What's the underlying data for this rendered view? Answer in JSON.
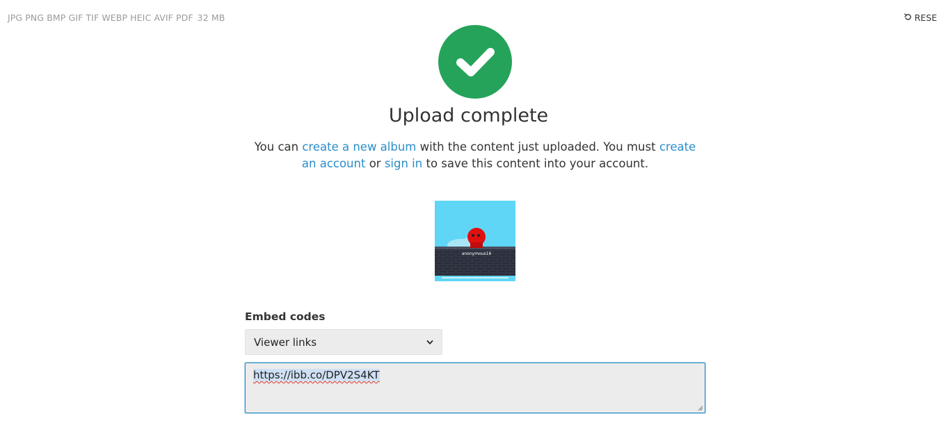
{
  "header": {
    "formats": "JPG PNG BMP GIF TIF WEBP HEIC AVIF PDF",
    "max_size": "32 MB",
    "reset_label": "RESE",
    "reset_icon": "undo-icon"
  },
  "status": {
    "icon": "check-circle-icon",
    "icon_color": "#25a35a",
    "title": "Upload complete"
  },
  "message": {
    "part1": "You can ",
    "link_album": "create a new album",
    "part2": " with the content just uploaded. You must ",
    "link_account": "create an account",
    "part3": " or ",
    "link_signin": "sign in",
    "part4": " to save this content into your account.",
    "link_color": "#2a8dc8"
  },
  "thumbnail": {
    "caption_text": "anonymous16"
  },
  "embed": {
    "label": "Embed codes",
    "selected_option": "Viewer links",
    "code_value": "https://ibb.co/DPV2S4KT"
  }
}
